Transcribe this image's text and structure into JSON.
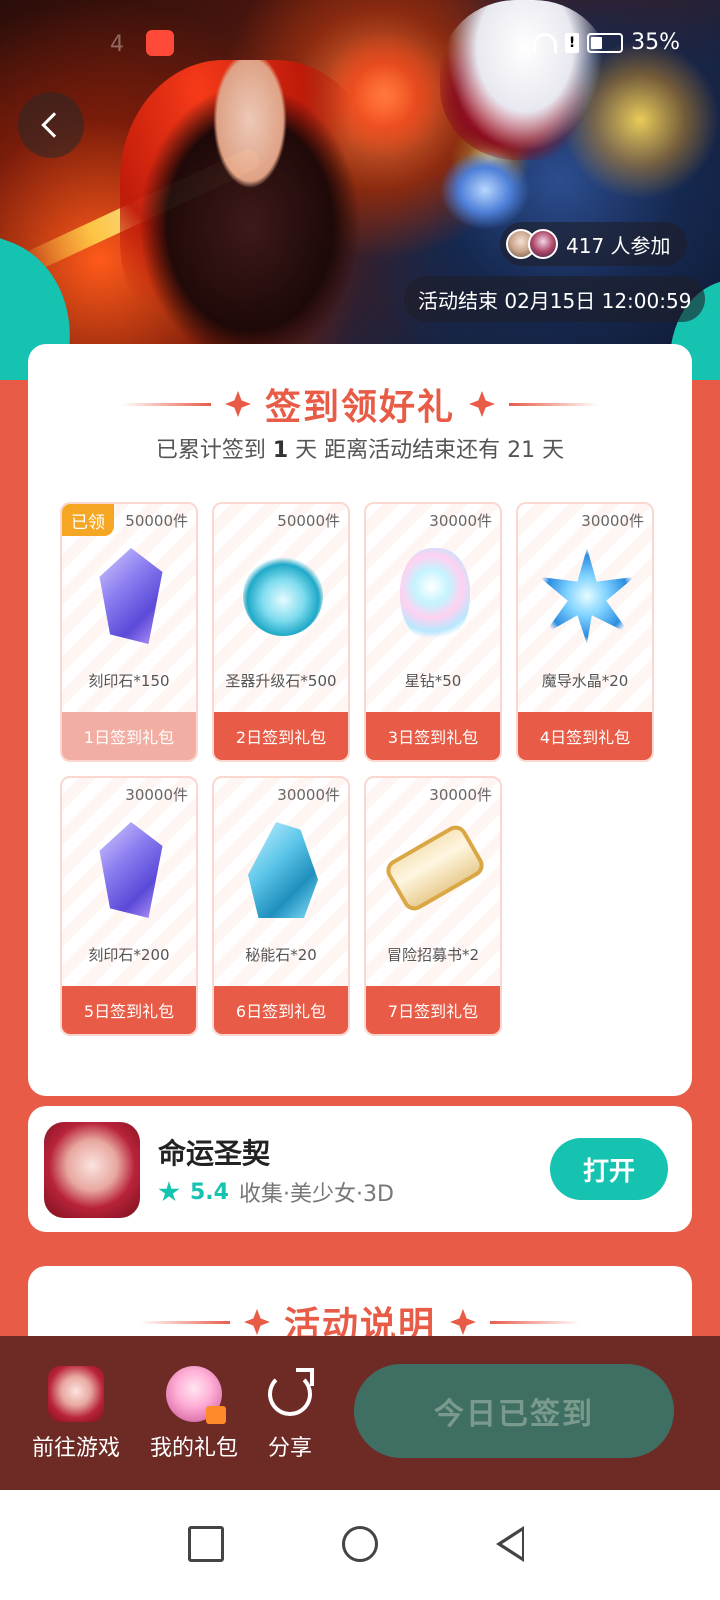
{
  "status_bar": {
    "time": "4",
    "battery": "35%"
  },
  "hero": {
    "participants": "417 人参加",
    "end_time": "活动结束 02月15日 12:00:59"
  },
  "signin": {
    "title": "签到领好礼",
    "subtitle_prefix": "已累计签到",
    "days_signed": "1",
    "subtitle_middle": "天  距离活动结束还有 21 天",
    "claimed_badge": "已领",
    "gifts": [
      {
        "qty": "50000件",
        "name": "刻印石*150",
        "label": "1日签到礼包",
        "icon": "rune-stone-icon",
        "claimed": true
      },
      {
        "qty": "50000件",
        "name": "圣器升级石*500",
        "label": "2日签到礼包",
        "icon": "relic-icon",
        "claimed": false
      },
      {
        "qty": "30000件",
        "name": "星钻*50",
        "label": "3日签到礼包",
        "icon": "star-gem-icon",
        "claimed": false
      },
      {
        "qty": "30000件",
        "name": "魔导水晶*20",
        "label": "4日签到礼包",
        "icon": "magic-crystal-icon",
        "claimed": false
      },
      {
        "qty": "30000件",
        "name": "刻印石*200",
        "label": "5日签到礼包",
        "icon": "rune-stone-icon",
        "claimed": false
      },
      {
        "qty": "30000件",
        "name": "秘能石*20",
        "label": "6日签到礼包",
        "icon": "arcane-stone-icon",
        "claimed": false
      },
      {
        "qty": "30000件",
        "name": "冒险招募书*2",
        "label": "7日签到礼包",
        "icon": "scroll-icon",
        "claimed": false
      }
    ]
  },
  "game": {
    "name": "命运圣契",
    "rating": "5.4",
    "tags": "收集·美少女·3D",
    "open_label": "打开"
  },
  "info": {
    "title": "活动说明"
  },
  "action_bar": {
    "goto_game": "前往游戏",
    "my_gifts": "我的礼包",
    "share": "分享",
    "signed_today": "今日已签到"
  },
  "colors": {
    "accent": "#e85c47",
    "teal": "#16c2b0",
    "bar": "#6e2a24"
  }
}
